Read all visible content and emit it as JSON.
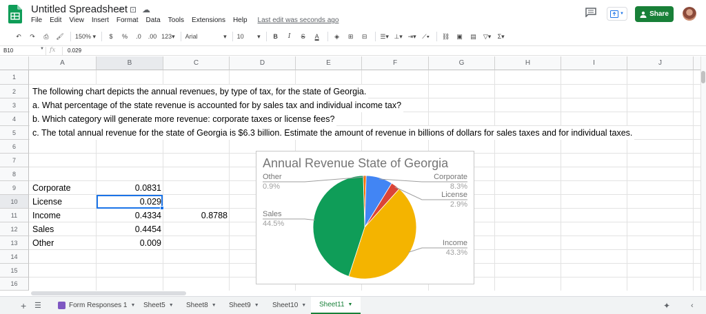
{
  "doc": {
    "title": "Untitled Spreadsheet",
    "last_edit": "Last edit was seconds ago"
  },
  "menu": [
    "File",
    "Edit",
    "View",
    "Insert",
    "Format",
    "Data",
    "Tools",
    "Extensions",
    "Help"
  ],
  "share_label": "Share",
  "toolbar": {
    "zoom": "150%",
    "currency": "$",
    "percent": "%",
    "dec_less": ".0",
    "dec_more": ".00",
    "format": "123",
    "font": "Arial",
    "size": "10",
    "bold": "B",
    "italic": "I",
    "strike": "S",
    "text_color": "A"
  },
  "formula_bar": {
    "name_box": "B10",
    "fx": "fx",
    "value": "0.029"
  },
  "columns": [
    "A",
    "B",
    "C",
    "D",
    "E",
    "F",
    "G",
    "H",
    "I",
    "J"
  ],
  "rows": [
    "1",
    "2",
    "3",
    "4",
    "5",
    "6",
    "7",
    "8",
    "9",
    "10",
    "11",
    "12",
    "13",
    "14",
    "15",
    "16"
  ],
  "cells": {
    "a2": "The following chart depicts the annual revenues, by type of tax, for the state of Georgia.",
    "a3": "a. What percentage of the state revenue is accounted for by sales tax and individual income tax?",
    "a4": "b. Which category will generate more revenue: corporate taxes or license fees?",
    "a5": "c. The total annual revenue for the state of Georgia is $6.3 billion. Estimate the amount of revenue in billions of dollars for sales taxes and for individual taxes.",
    "a9": "Corporate",
    "b9": "0.0831",
    "a10": "License",
    "b10": "0.029",
    "a11": "Income",
    "b11": "0.4334",
    "c11": "0.8788",
    "a12": "Sales",
    "b12": "0.4454",
    "a13": "Other",
    "b13": "0.009"
  },
  "chart_data": {
    "type": "pie",
    "title": "Annual Revenue State of Georgia",
    "slices": [
      {
        "label": "Corporate",
        "value": 8.3,
        "pct_label": "8.3%",
        "color": "#4285f4"
      },
      {
        "label": "License",
        "value": 2.9,
        "pct_label": "2.9%",
        "color": "#db4437"
      },
      {
        "label": "Income",
        "value": 43.3,
        "pct_label": "43.3%",
        "color": "#f4b400"
      },
      {
        "label": "Sales",
        "value": 44.5,
        "pct_label": "44.5%",
        "color": "#0f9d58"
      },
      {
        "label": "Other",
        "value": 0.9,
        "pct_label": "0.9%",
        "color": "#ff6d00"
      }
    ]
  },
  "sheets": [
    {
      "label": "Form Responses 1"
    },
    {
      "label": "Sheet5"
    },
    {
      "label": "Sheet8"
    },
    {
      "label": "Sheet9"
    },
    {
      "label": "Sheet10"
    },
    {
      "label": "Sheet11",
      "active": true
    }
  ],
  "colors": {
    "green": "#188038",
    "blue": "#1a73e8"
  }
}
